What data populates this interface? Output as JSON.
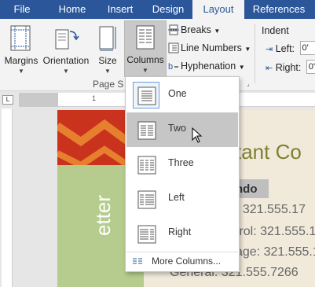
{
  "tabs": [
    {
      "label": "File",
      "active": false
    },
    {
      "label": "Home",
      "active": false
    },
    {
      "label": "Insert",
      "active": false
    },
    {
      "label": "Design",
      "active": false
    },
    {
      "label": "Layout",
      "active": true
    },
    {
      "label": "References",
      "active": false
    }
  ],
  "ribbon": {
    "margins_label": "Margins",
    "orientation_label": "Orientation",
    "size_label": "Size",
    "columns_label": "Columns",
    "breaks_label": "Breaks",
    "line_numbers_label": "Line Numbers",
    "hyphenation_label": "Hyphenation",
    "group_label": "Page S",
    "indent_title": "Indent",
    "indent_left_label": "Left:",
    "indent_left_value": "0'",
    "indent_right_label": "Right:",
    "indent_right_value": "0'"
  },
  "ruler": {
    "numbers": [
      "1",
      "1"
    ]
  },
  "columns_menu": {
    "items": [
      {
        "label": "One",
        "icon": "one-column-icon",
        "selected": true,
        "hovered": false
      },
      {
        "label": "Two",
        "icon": "two-columns-icon",
        "selected": false,
        "hovered": true
      },
      {
        "label": "Three",
        "icon": "three-columns-icon",
        "selected": false,
        "hovered": false
      },
      {
        "label": "Left",
        "icon": "left-column-icon",
        "selected": false,
        "hovered": false
      },
      {
        "label": "Right",
        "icon": "right-column-icon",
        "selected": false,
        "hovered": false
      }
    ],
    "more_label": "More Columns..."
  },
  "document": {
    "vertical_text": "etter",
    "heading": "tant Co",
    "name": "ndo",
    "lines": [
      ": 321.555.17",
      "trol: 321.555.1",
      "age: 321.555.1",
      "General: 321.555.7266"
    ]
  },
  "colors": {
    "tab_bar": "#2b579a",
    "doc_red": "#c9331e",
    "doc_green": "#b5cc8e",
    "heading": "#7e7f30"
  }
}
